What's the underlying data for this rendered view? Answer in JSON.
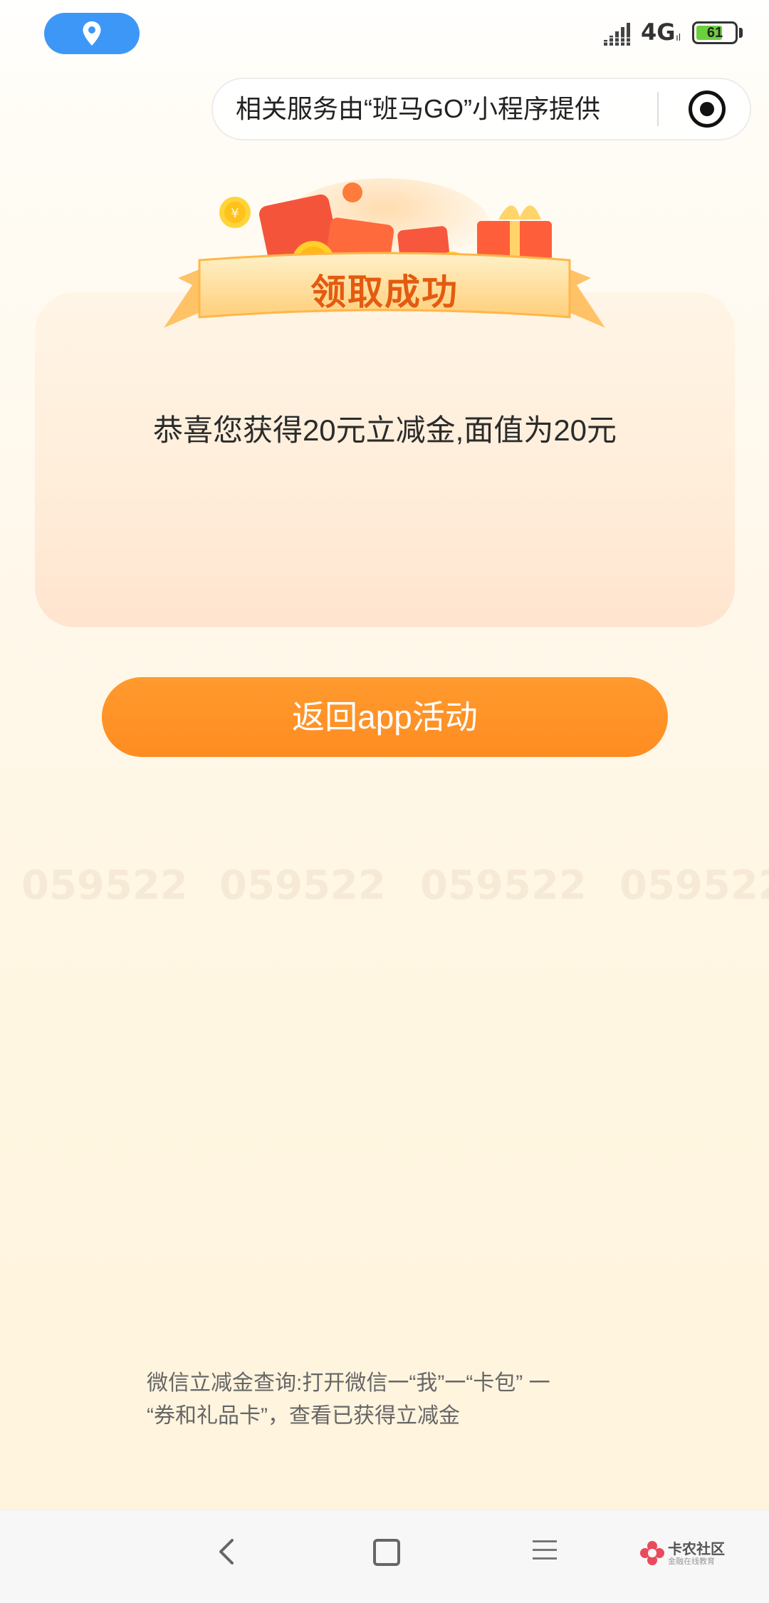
{
  "status_bar": {
    "network": "4G",
    "network_sub": "ıl",
    "battery": "61",
    "icons": [
      "location-icon",
      "signal-icon",
      "battery-icon"
    ]
  },
  "header": {
    "service_text": "相关服务由“班马GO”小程序提供",
    "icon": "record-icon"
  },
  "banner": {
    "title": "领取成功"
  },
  "card": {
    "message": "恭喜您获得20元立减金,面值为20元"
  },
  "actions": {
    "return_label": "返回app活动"
  },
  "footer": {
    "note_line1": "微信立减金查询:打开微信一“我”一“卡包” 一",
    "note_line2": "“券和礼品卡”，查看已获得立减金"
  },
  "watermark": {
    "text": "059522"
  },
  "nav_bar": {
    "brand_name": "卡农社区",
    "brand_sub": "金融在线教育",
    "icons": [
      "back-icon",
      "home-icon",
      "menu-icon"
    ]
  },
  "colors": {
    "accent": "#ff8c21",
    "location_pill": "#3d97f6",
    "banner_title": "#e35b10"
  }
}
